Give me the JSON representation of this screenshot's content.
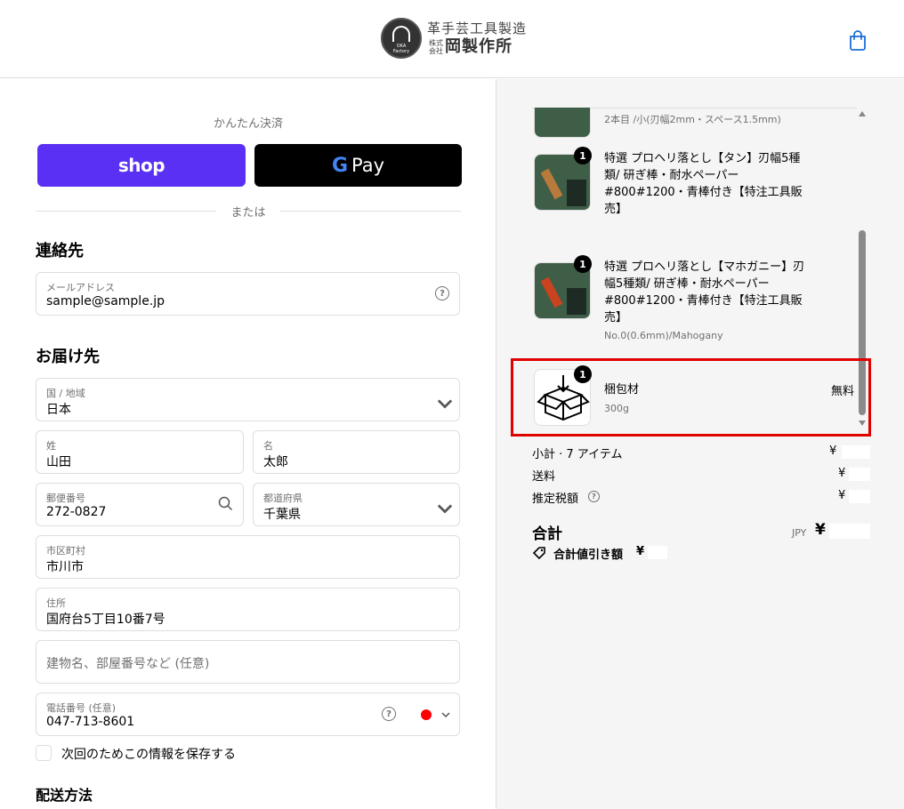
{
  "header": {
    "logo_top": "革手芸工具製造",
    "logo_small": "株式\n会社",
    "logo_main": "岡製作所",
    "logo_circle_text": "OKA\nFactory",
    "cart_icon": "shopping-bag-icon"
  },
  "express": {
    "title": "かんたん決済",
    "shop_label": "shop",
    "gpay_g": "G",
    "gpay_label": "Pay",
    "divider": "または"
  },
  "contact": {
    "heading": "連絡先",
    "email_label": "メールアドレス",
    "email_value": "sample@sample.jp",
    "help_icon": "?"
  },
  "delivery": {
    "heading": "お届け先",
    "country_label": "国 / 地域",
    "country_value": "日本",
    "last_name_label": "姓",
    "last_name_value": "山田",
    "first_name_label": "名",
    "first_name_value": "太郎",
    "postal_label": "郵便番号",
    "postal_value": "272-0827",
    "prefecture_label": "都道府県",
    "prefecture_value": "千葉県",
    "city_label": "市区町村",
    "city_value": "市川市",
    "address_label": "住所",
    "address_value": "国府台5丁目10番7号",
    "building_placeholder": "建物名、部屋番号など (任意)",
    "phone_label": "電話番号 (任意)",
    "phone_value": "047-713-8601",
    "save_info": "次回のためこの情報を保存する",
    "shipping_method": "配送方法"
  },
  "cart": {
    "items": [
      {
        "name": "",
        "sub": "2本目 /小(刃幅2mm・スペース1.5mm)",
        "qty": ""
      },
      {
        "name": "特選 プロヘリ落とし【タン】刃幅5種類/ 研ぎ棒・耐水ペーパー#800#1200・青棒付き【特注工具販売】",
        "sub": "",
        "qty": "1"
      },
      {
        "name": "特選 プロヘリ落とし【マホガニー】刃幅5種類/ 研ぎ棒・耐水ペーパー#800#1200・青棒付き【特注工具販売】",
        "sub": "No.0(0.6mm)/Mahogany",
        "qty": "1"
      },
      {
        "name": "梱包材",
        "sub": "300g",
        "qty": "1",
        "price": "無料"
      }
    ],
    "subtotal_label": "小計 · 7 アイテム",
    "subtotal_value": "¥",
    "shipping_label": "送料",
    "shipping_value": "¥",
    "tax_label": "推定税額",
    "tax_value": "¥",
    "total_label": "合計",
    "currency": "JPY",
    "total_value": "¥",
    "discount_label": "合計値引き額",
    "discount_value": "¥"
  },
  "colors": {
    "shop_pay": "#5a31f4",
    "highlight": "#e00000",
    "flag_dot": "#ff0000"
  }
}
